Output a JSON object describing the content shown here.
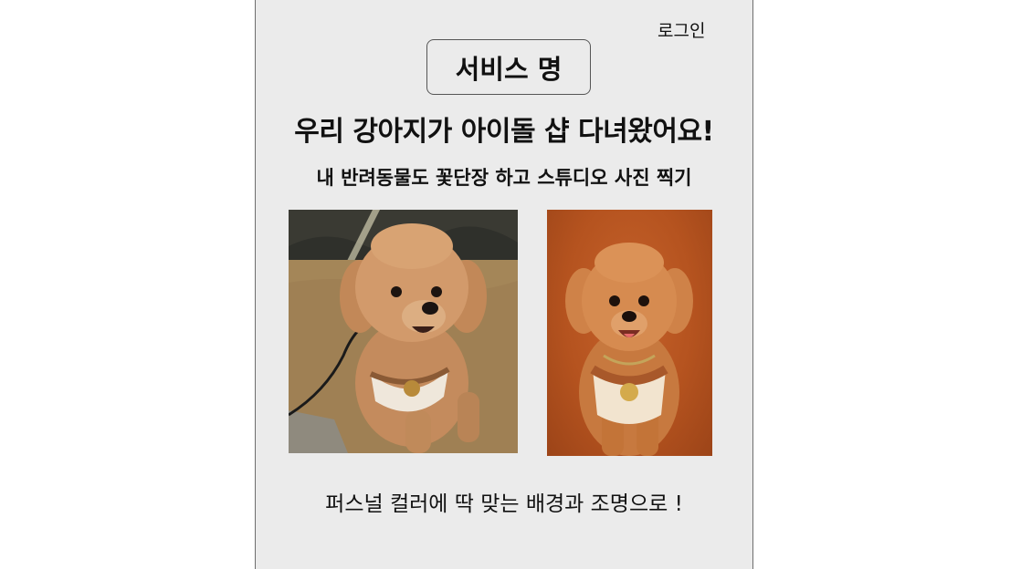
{
  "header": {
    "login_label": "로그인",
    "service_name": "서비스 명"
  },
  "hero": {
    "headline": "우리 강아지가 아이돌 샵 다녀왔어요!",
    "subheadline": "내 반려동물도 꽃단장 하고 스튜디오 사진 찍기"
  },
  "gallery": {
    "images": [
      {
        "name": "before-photo",
        "subject": "poodle-outdoor-photo"
      },
      {
        "name": "after-photo",
        "subject": "poodle-studio-portrait"
      }
    ]
  },
  "footer": {
    "caption": "퍼스널 컬러에 딱 맞는 배경과 조명으로 !"
  },
  "colors": {
    "page_bg": "#ebebeb",
    "studio_bg": "#b5531f",
    "dog_fur": "#c98b55"
  }
}
